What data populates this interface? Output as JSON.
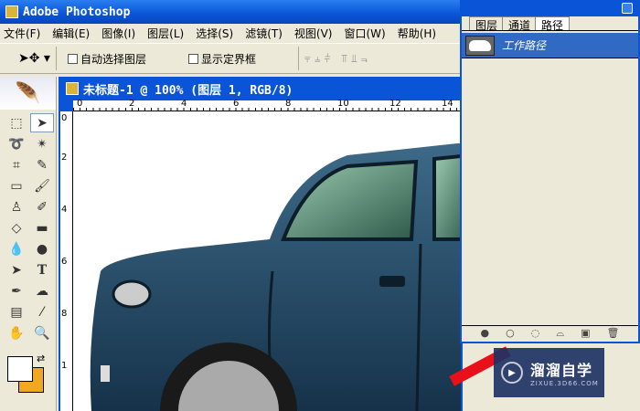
{
  "app": {
    "title": "Adobe Photoshop"
  },
  "menu": [
    "文件(F)",
    "编辑(E)",
    "图像(I)",
    "图层(L)",
    "选择(S)",
    "滤镜(T)",
    "视图(V)",
    "窗口(W)",
    "帮助(H)"
  ],
  "options": {
    "auto_select": "自动选择图层",
    "show_bounds": "显示定界框",
    "align_icons": "⫧⫨⫩ ⫪⫫⫬"
  },
  "document": {
    "title": "未标题-1 @ 100% (图层 1, RGB/8)",
    "hruler": [
      "0",
      "2",
      "4",
      "6",
      "8",
      "10",
      "12",
      "14"
    ],
    "vruler": [
      "0",
      "2",
      "4",
      "6",
      "8",
      "1"
    ]
  },
  "panel": {
    "tabs": [
      "图层",
      "通道",
      "路径"
    ],
    "active_tab": "路径",
    "path_name": "工作路径"
  },
  "colors": {
    "foreground": "#ffffff",
    "background": "#f0a820"
  },
  "watermark": {
    "title": "溜溜自学",
    "url": "ZIXUE.3D66.COM"
  }
}
